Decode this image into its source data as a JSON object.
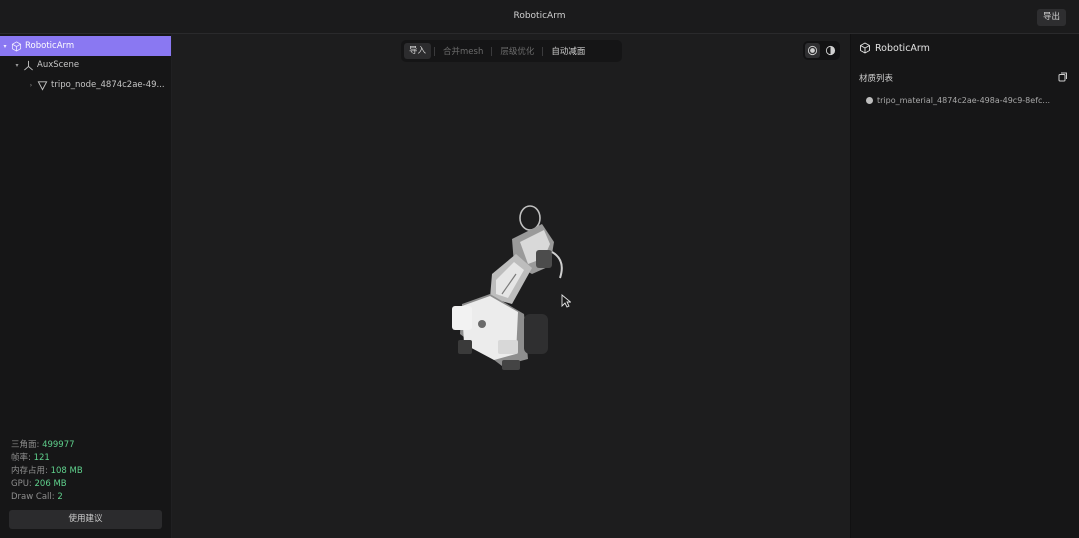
{
  "app": {
    "title": "RoboticArm",
    "export_label": "导出"
  },
  "scene_tree": {
    "items": [
      {
        "label": "RoboticArm",
        "icon": "cube-icon",
        "selected": true
      },
      {
        "label": "AuxScene",
        "icon": "axes-icon",
        "selected": false
      },
      {
        "label": "tripo_node_4874c2ae-49...",
        "icon": "triangle-mesh-icon",
        "selected": false
      }
    ]
  },
  "stats": {
    "triangles_label": "三角面:",
    "triangles_value": "499977",
    "fps_label": "帧率:",
    "fps_value": "121",
    "memory_label": "内存占用:",
    "memory_value": "108 MB",
    "gpu_label": "GPU:",
    "gpu_value": "206 MB",
    "drawcall_label": "Draw Call:",
    "drawcall_value": "2"
  },
  "suggest_label": "使用建议",
  "toolbar": {
    "import": "导入",
    "merge": "合并mesh",
    "lod": "层级优化",
    "auto_reduce": "自动减面"
  },
  "inspector": {
    "object_name": "RoboticArm",
    "materials_title": "材质列表",
    "materials": [
      "tripo_material_4874c2ae-498a-49c9-8efc..."
    ]
  },
  "colors": {
    "accent": "#8a78f2",
    "stat_value": "#5fd08c"
  }
}
